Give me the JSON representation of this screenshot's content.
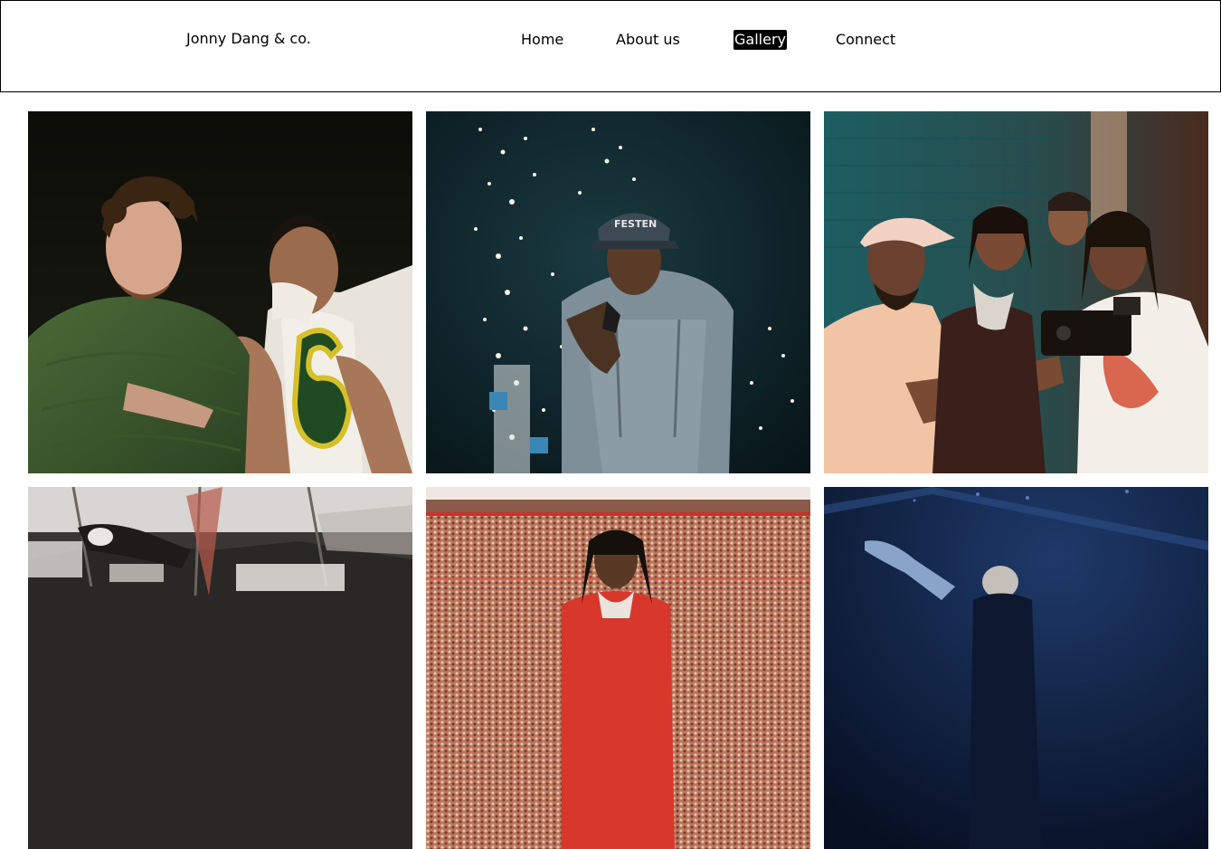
{
  "header": {
    "brand": "Jonny Dang & co.",
    "nav": {
      "home": "Home",
      "about": "About us",
      "gallery": "Gallery",
      "connect": "Connect"
    },
    "active": "Gallery"
  },
  "gallery": {
    "photos": [
      {
        "subject": "two men posing at night, one in green shirt, one in white jersey number 6"
      },
      {
        "subject": "performer with cap singing on stage with sparkler fountains"
      },
      {
        "subject": "group of people looking at a camera rig in teal-lit room"
      },
      {
        "subject": "reflective mirrored interior with a person"
      },
      {
        "subject": "man in red jacket standing in a basketball arena"
      },
      {
        "subject": "performer silhouette on blue-lit stage"
      }
    ],
    "jersey_number": "6",
    "cap_text": "FESTEN"
  }
}
